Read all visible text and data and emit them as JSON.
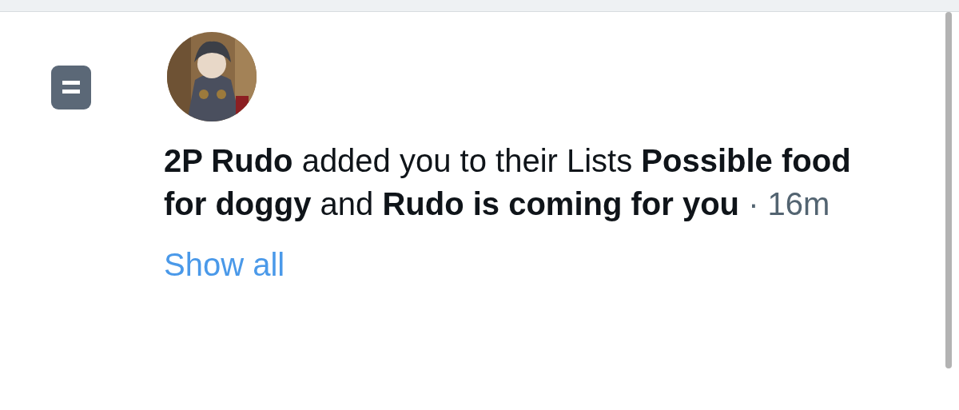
{
  "notification": {
    "kind": "list",
    "message": "**2P Rudo** added you to their Lists **Possible food for doggy** and **Rudo is coming for you**",
    "time": "· 16m",
    "link": "Show all"
  }
}
